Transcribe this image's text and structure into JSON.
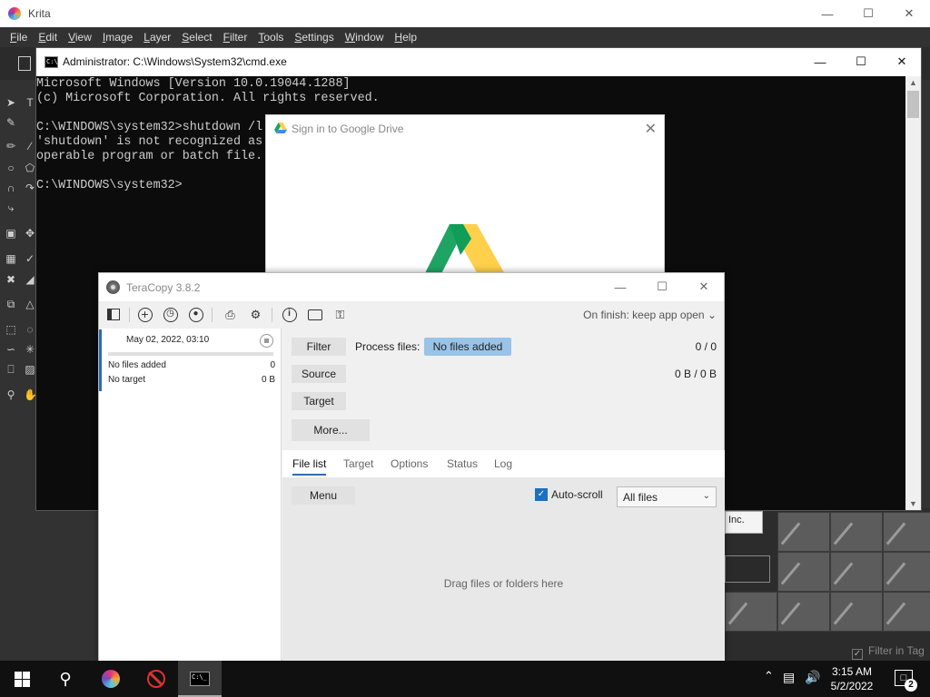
{
  "krita": {
    "title": "Krita",
    "menu": [
      "File",
      "Edit",
      "View",
      "Image",
      "Layer",
      "Select",
      "Filter",
      "Tools",
      "Settings",
      "Window",
      "Help"
    ],
    "docker": {
      "inc_text": "Inc.",
      "filter_in_tag": "Filter in Tag"
    }
  },
  "cmd": {
    "title": "Administrator: C:\\Windows\\System32\\cmd.exe",
    "lines": [
      "Microsoft Windows [Version 10.0.19044.1288]",
      "(c) Microsoft Corporation. All rights reserved.",
      "",
      "C:\\WINDOWS\\system32>shutdown /l",
      "'shutdown' is not recognized as",
      "operable program or batch file.",
      "",
      "C:\\WINDOWS\\system32>"
    ]
  },
  "gdrive": {
    "title": "Sign in to Google Drive",
    "colors": {
      "green": "#1fa463",
      "yellow": "#ffd04b",
      "blue": "#4688f4",
      "dark_green": "#0f9d58"
    }
  },
  "teracopy": {
    "title": "TeraCopy 3.8.2",
    "on_finish": "On finish: keep app open",
    "job": {
      "date": "May 02, 2022, 03:10",
      "files_label": "No files added",
      "files_count": "0",
      "target_label": "No target",
      "target_size": "0 B"
    },
    "buttons": {
      "filter": "Filter",
      "source": "Source",
      "target": "Target",
      "more": "More...",
      "menu": "Menu"
    },
    "process_files_label": "Process files:",
    "process_files_value": "No files added",
    "count": "0 / 0",
    "size": "0 B / 0 B",
    "tabs": [
      "File list",
      "Target",
      "Options",
      "Status",
      "Log"
    ],
    "active_tab": "File list",
    "autoscroll_label": "Auto-scroll",
    "autoscroll_checked": true,
    "filter_select": "All files",
    "drop_hint": "Drag files or folders here",
    "accent": "#2b6cb0"
  },
  "taskbar": {
    "time": "3:15 AM",
    "date": "5/2/2022",
    "notifications": "2"
  }
}
